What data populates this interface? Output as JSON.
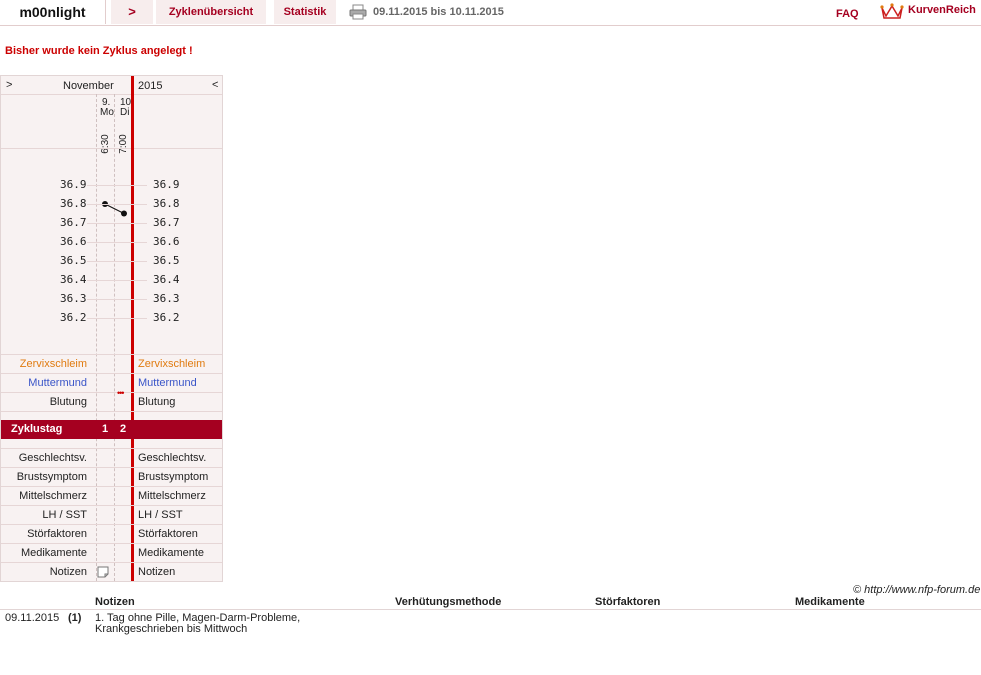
{
  "topbar": {
    "username": "m00nlight",
    "nav_arrow": ">",
    "tab_cycles": "Zyklenübersicht",
    "tab_stats": "Statistik",
    "daterange": "09.11.2015 bis 10.11.2015",
    "faq": "FAQ",
    "logo_text": "KurvenReich",
    "printer_icon": "printer-icon",
    "logo_icon": "crown-logo-icon"
  },
  "message": "Bisher wurde kein Zyklus angelegt !",
  "chart": {
    "prev": ">",
    "month": "November",
    "year": "2015",
    "next": "<",
    "days": [
      {
        "date": "9.",
        "weekday": "Mo",
        "time": "6:30"
      },
      {
        "date": "10.",
        "weekday": "Di",
        "time": "7:00"
      }
    ],
    "temp_ticks": [
      "36.9",
      "36.8",
      "36.7",
      "36.6",
      "36.5",
      "36.4",
      "36.3",
      "36.2"
    ],
    "temperatures": [
      36.8,
      36.75
    ],
    "rows_top": {
      "cervix": "Zervixschleim",
      "mumu": "Muttermund",
      "bleeding": "Blutung",
      "bleeding_mark": "•••"
    },
    "cycle_label": "Zyklustag",
    "cycle_days": [
      "1",
      "2"
    ],
    "rows_bottom": [
      "Geschlechtsv.",
      "Brustsymptom",
      "Mittelschmerz",
      "LH / SST",
      "Störfaktoren",
      "Medikamente",
      "Notizen"
    ],
    "colors": {
      "accent": "#a50020",
      "red_line": "#cc0000",
      "cervix": "#e07b10",
      "mumu": "#3a55c8"
    }
  },
  "copyright": "© http://www.nfp-forum.de",
  "notes": {
    "headers": [
      "Notizen",
      "Verhütungsmethode",
      "Störfaktoren",
      "Medikamente"
    ],
    "rows": [
      {
        "date": "09.11.2015",
        "num": "(1)",
        "line1": "1. Tag ohne Pille, Magen-Darm-Probleme,",
        "line2": "Krankgeschrieben bis Mittwoch"
      }
    ]
  }
}
